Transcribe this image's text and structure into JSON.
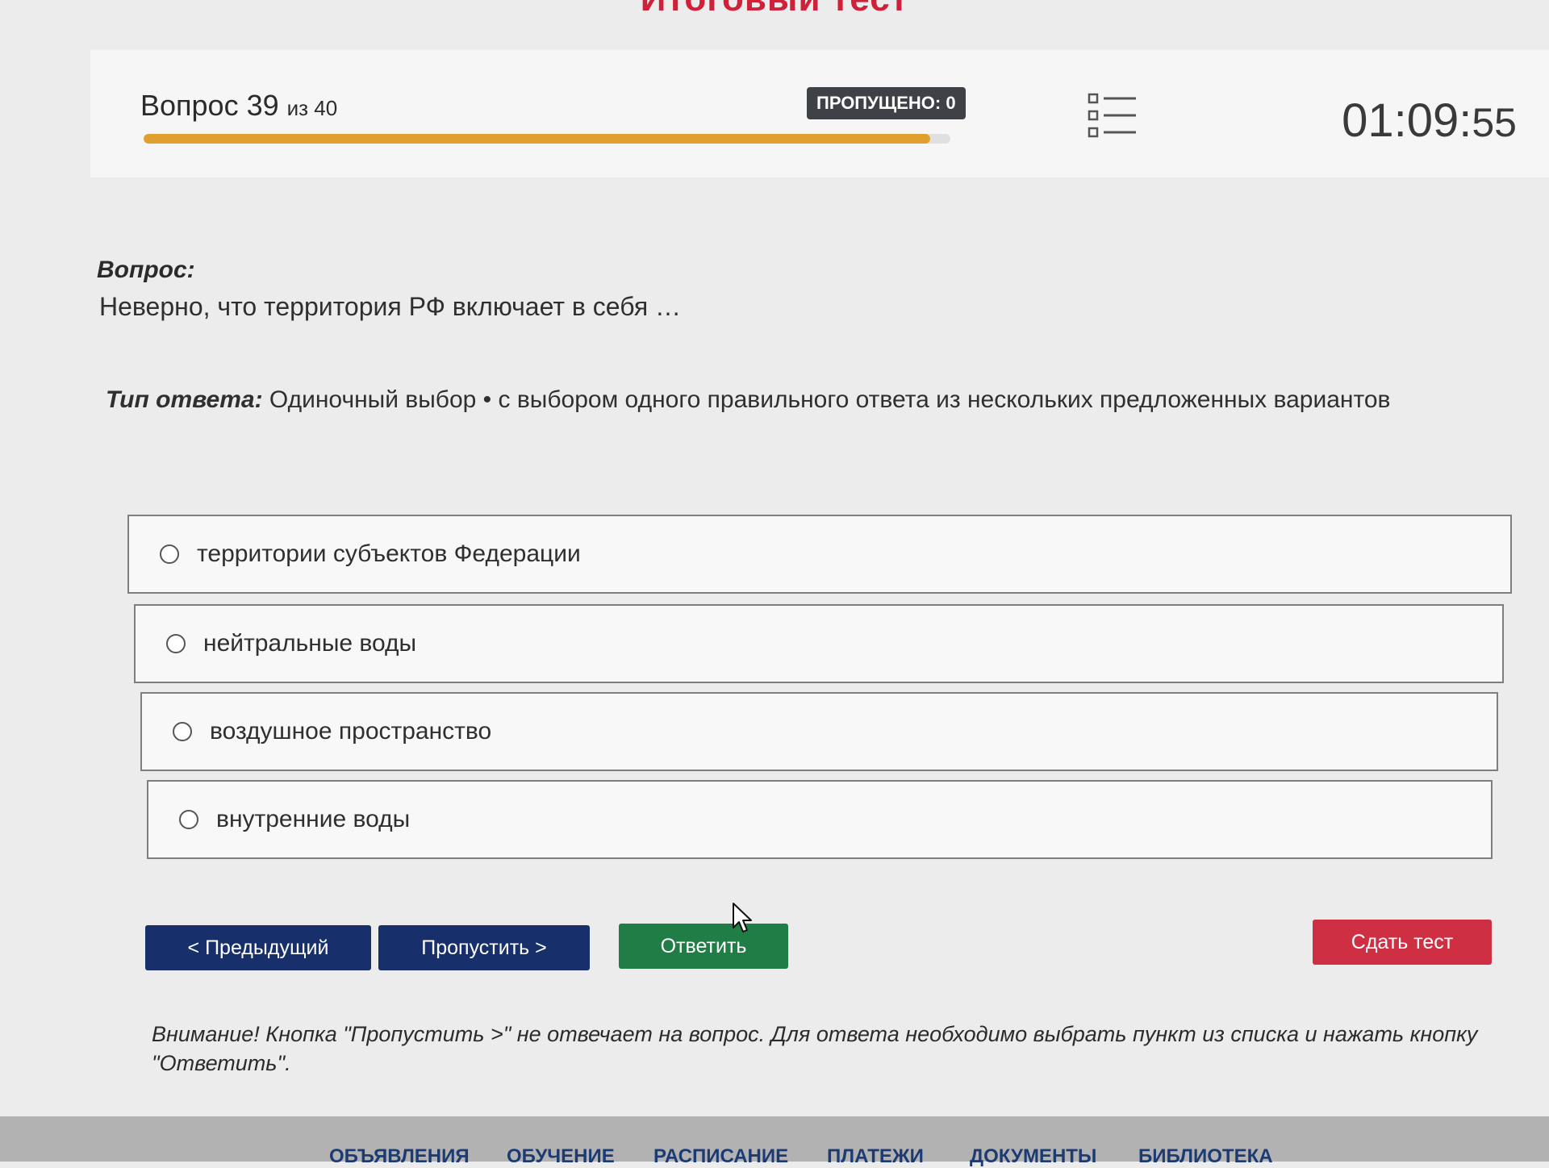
{
  "page_heading": "Итоговый тест",
  "status": {
    "question_label": "Вопрос 39",
    "question_total": "из 40",
    "progress_fraction": 0.975,
    "skipped_badge": "ПРОПУЩЕНО: 0",
    "list_icon": "list-icon",
    "timer_main": "01:09:",
    "timer_seconds": "55"
  },
  "question": {
    "label": "Вопрос:",
    "text": "Неверно, что территория РФ включает в себя …"
  },
  "answer_type": {
    "label": "Тип ответа:",
    "value": " Одиночный выбор • с выбором одного правильного ответа из нескольких предложенных вариантов"
  },
  "options": [
    {
      "label": "территории субъектов Федерации"
    },
    {
      "label": "нейтральные воды"
    },
    {
      "label": "воздушное пространство"
    },
    {
      "label": "внутренние воды"
    }
  ],
  "buttons": {
    "prev": "< Предыдущий",
    "skip": "Пропустить >",
    "answer": "Ответить",
    "submit": "Сдать тест"
  },
  "warning": "Внимание! Кнопка \"Пропустить >\" не отвечает на вопрос. Для ответа необходимо выбрать пункт из списка и нажать кнопку \"Ответить\".",
  "footer_nav": [
    "ОБЪЯВЛЕНИЯ",
    "ОБУЧЕНИЕ",
    "РАСПИСАНИЕ",
    "ПЛАТЕЖИ",
    "ДОКУМЕНТЫ",
    "БИБЛИОТЕКА"
  ],
  "colors": {
    "progress": "#e0a030",
    "nav_button": "#17306b",
    "answer_button": "#1f7d45",
    "submit_button": "#cf2f43",
    "heading": "#d0213a"
  }
}
